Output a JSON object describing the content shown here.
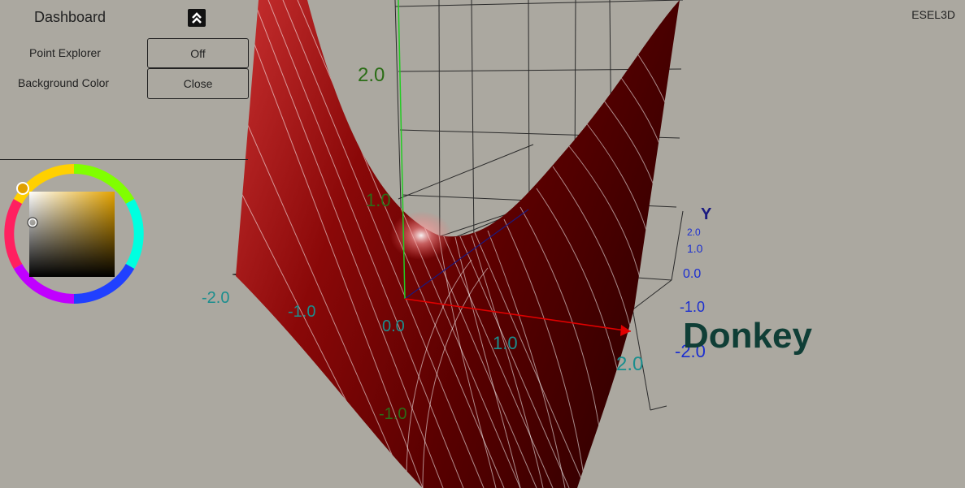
{
  "panel": {
    "title": "Dashboard",
    "collapse_icon": "double-chevron-up-icon",
    "rows": [
      {
        "label": "Point Explorer",
        "button": "Off"
      },
      {
        "label": "Background Color",
        "button": "Close"
      }
    ]
  },
  "brand": "ESEL3D",
  "colors": {
    "background": "#aba8a0",
    "surface": "#6e0000",
    "x_axis": "#e00000",
    "y_axis": "#1a1a80",
    "z_axis": "#22cc22",
    "tick_x": "#1b8e8e",
    "tick_y": "#1c2fd0",
    "tick_z": "#2b6d17",
    "annotation": "#0f3e36"
  },
  "axes": {
    "x_ticks": [
      "-2.0",
      "-1.0",
      "0.0",
      "1.0",
      "2.0"
    ],
    "z_ticks": [
      "2.0",
      "1.0",
      "-1.0"
    ],
    "y_title": "Y",
    "y_ticks": [
      "2.0",
      "1.0",
      "0.0",
      "-1.0",
      "-2.0"
    ]
  },
  "annotation": "Donkey"
}
